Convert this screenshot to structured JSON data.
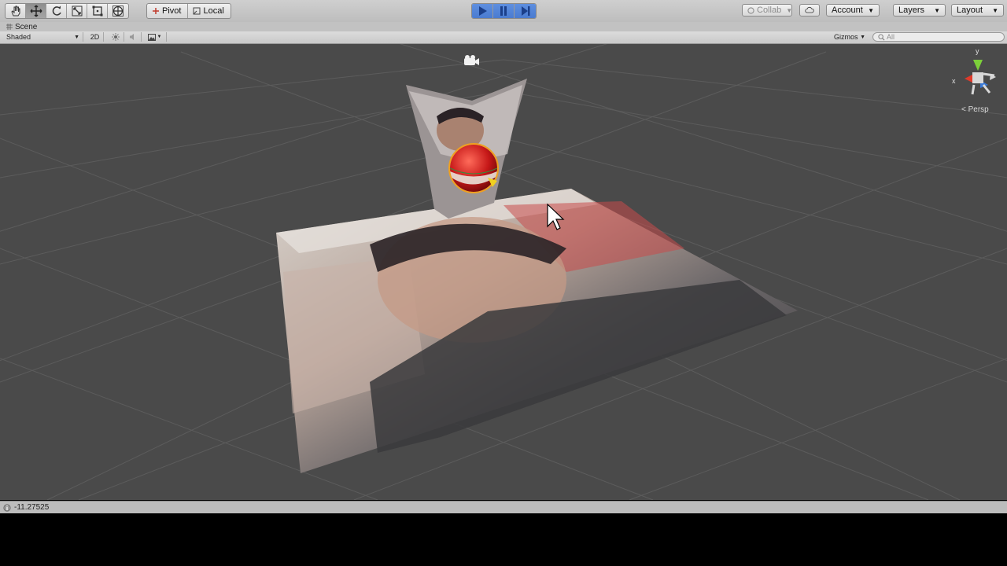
{
  "toolbar": {
    "transform_tools": [
      "hand-tool",
      "move-tool",
      "rotate-tool",
      "scale-tool",
      "rect-tool",
      "transform-tool"
    ],
    "pivot_label": "Pivot",
    "local_label": "Local",
    "collab_label": "Collab",
    "account_label": "Account",
    "layers_label": "Layers",
    "layout_label": "Layout"
  },
  "scene": {
    "tab_label": "Scene",
    "shading_mode": "Shaded",
    "mode_2d": "2D",
    "gizmos_label": "Gizmos",
    "search_placeholder": "All",
    "projection_label": "Persp",
    "axis_x_label": "x",
    "axis_y_label": "y"
  },
  "status": {
    "value": "-11.27525"
  },
  "colors": {
    "play_active": "#4a7bd0",
    "viewport_bg": "#4a4a4a",
    "gizmo_x": "#e03a2a",
    "gizmo_y": "#7ccf3a",
    "gizmo_z": "#3a7ad8"
  }
}
